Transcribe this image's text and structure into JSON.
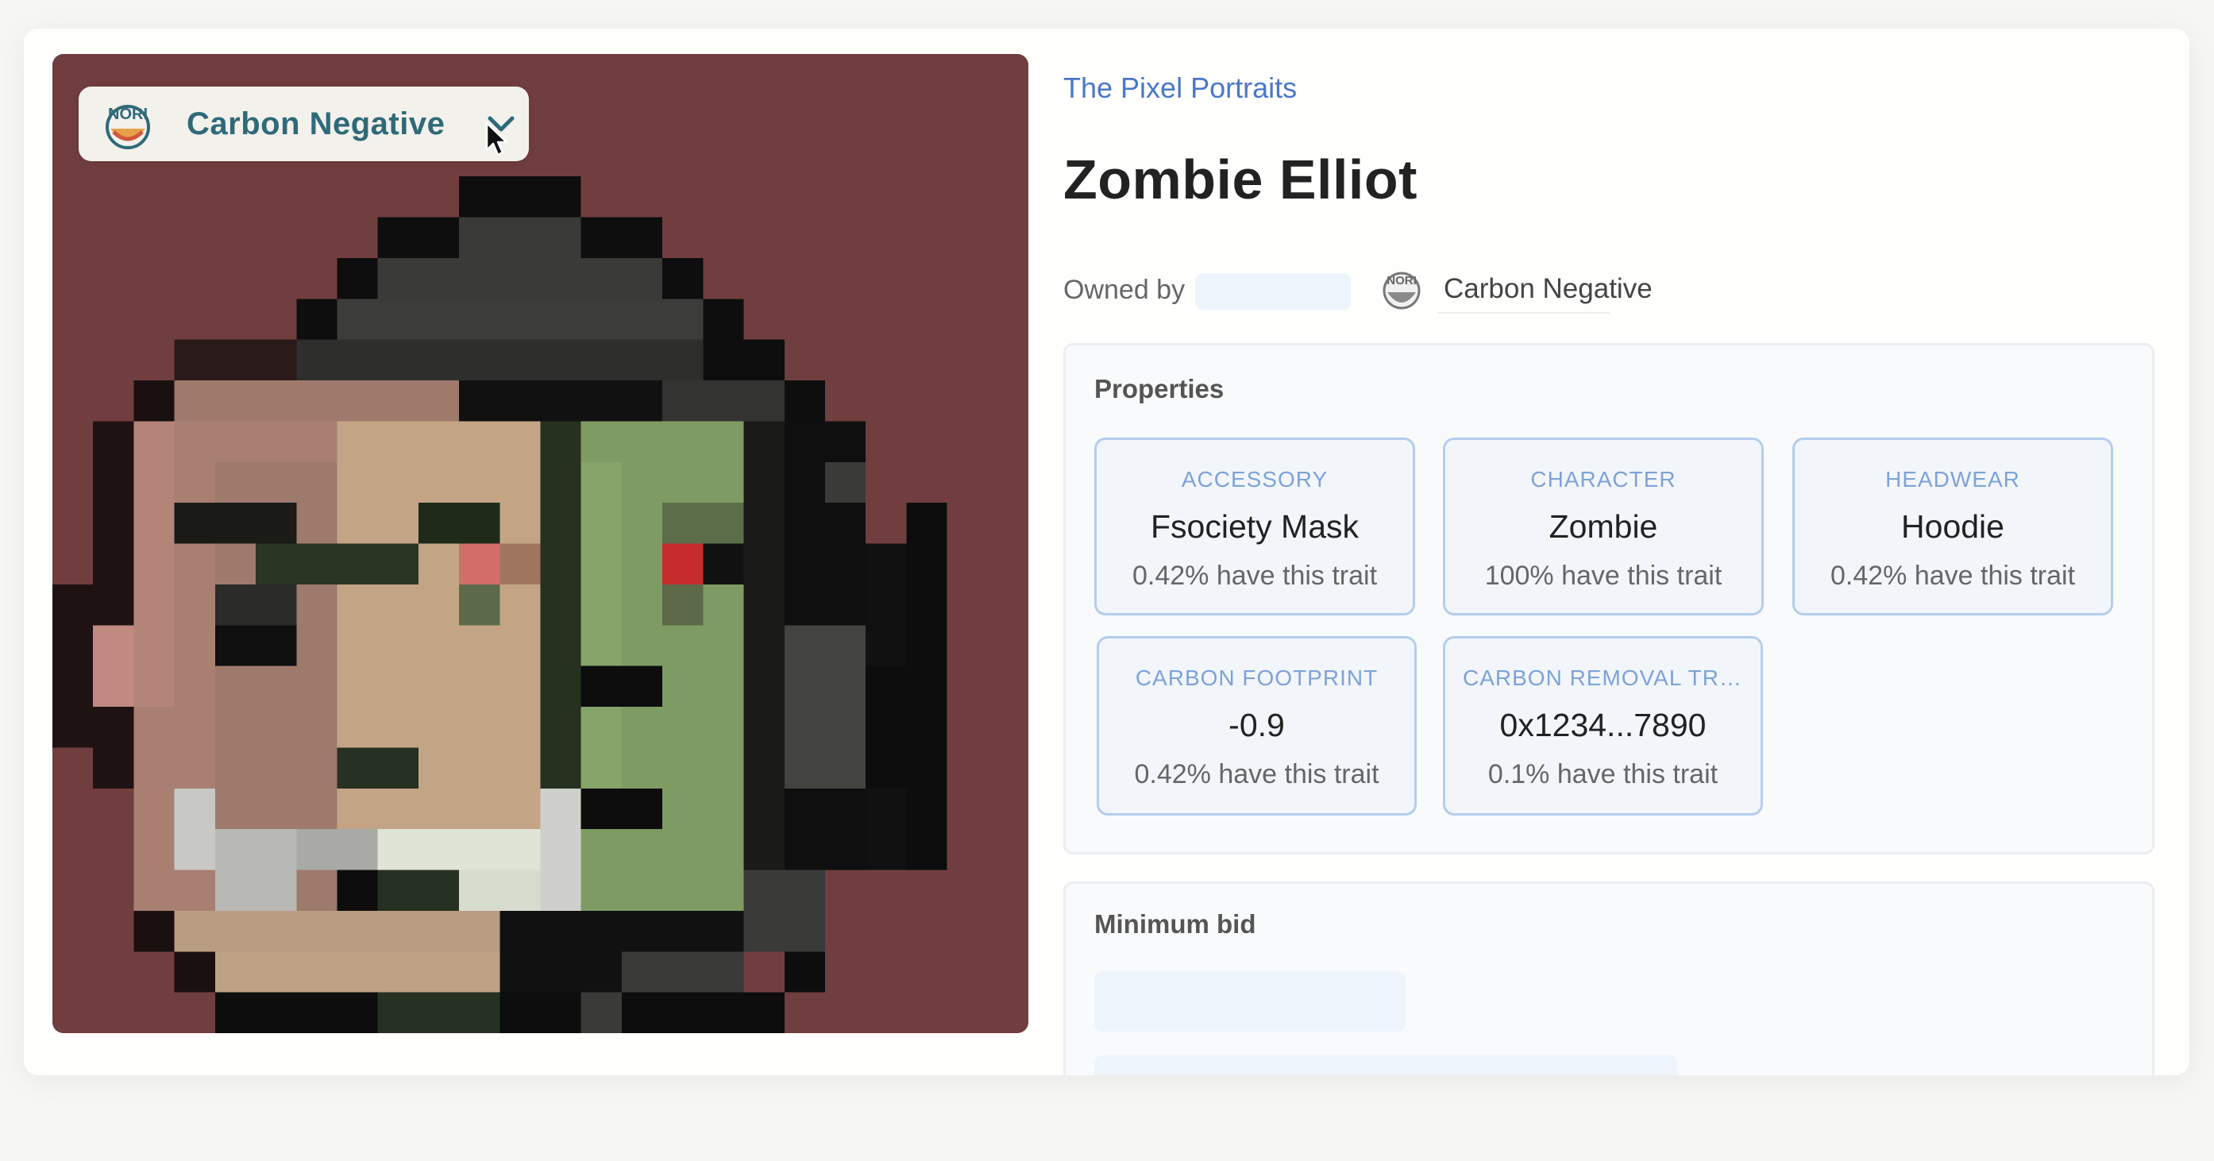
{
  "badge": {
    "label": "Carbon Negative",
    "logo_text": "NORI",
    "icon": "chevron-down-icon"
  },
  "collection": {
    "name": "The Pixel Portraits"
  },
  "nft": {
    "title": "Zombie Elliot"
  },
  "ownership": {
    "owned_by_label": "Owned by",
    "owner_name": "Carbon Negative"
  },
  "properties": {
    "heading": "Properties",
    "traits": [
      {
        "type": "ACCESSORY",
        "value": "Fsociety Mask",
        "rarity": "0.42% have this trait"
      },
      {
        "type": "CHARACTER",
        "value": "Zombie",
        "rarity": "100% have this trait"
      },
      {
        "type": "HEADWEAR",
        "value": "Hoodie",
        "rarity": "0.42% have this trait"
      },
      {
        "type": "CARBON FOOTPRINT",
        "value": "-0.9",
        "rarity": "0.42% have this trait"
      },
      {
        "type": "CARBON REMOVAL TRANSACTION",
        "value": "0x1234...7890",
        "rarity": "0.1% have this trait"
      }
    ]
  },
  "minimum_bid": {
    "heading": "Minimum bid"
  },
  "colors": {
    "art_background": "#713e3f",
    "accent_link": "#4a78c8",
    "trait_border": "#b4cdee",
    "trait_type": "#7ea2d8",
    "badge_text": "#2f6a79"
  }
}
